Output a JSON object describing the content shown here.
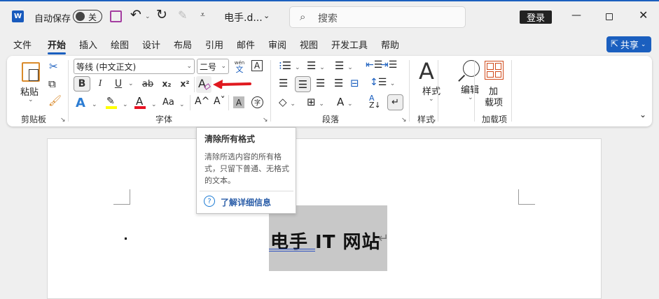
{
  "titlebar": {
    "app_icon": "word-icon",
    "autosave_label": "自动保存",
    "autosave_toggle": "关",
    "doc_title": "电手.d...",
    "search_placeholder": "搜索",
    "login_label": "登录"
  },
  "tabs": [
    "文件",
    "开始",
    "插入",
    "绘图",
    "设计",
    "布局",
    "引用",
    "邮件",
    "审阅",
    "视图",
    "开发工具",
    "帮助"
  ],
  "share_label": "共享",
  "ribbon": {
    "clipboard": {
      "paste": "粘贴",
      "group": "剪贴板"
    },
    "font": {
      "font_name": "等线 (中文正文)",
      "font_size": "二号",
      "phonetic": "wén",
      "phonetic_char": "文",
      "bold": "B",
      "italic": "I",
      "underline": "U",
      "strike": "ab",
      "sub": "x₂",
      "sup": "x²",
      "case": "Aa",
      "grow": "A^",
      "shrink": "Aˇ",
      "shade": "A",
      "enclose": "字",
      "group": "字体"
    },
    "paragraph": {
      "group": "段落"
    },
    "styles": {
      "label": "样式",
      "group": "样式"
    },
    "editing": {
      "label": "编辑"
    },
    "addins": {
      "label_1": "加",
      "label_2": "载项",
      "group": "加载项"
    }
  },
  "tooltip": {
    "title": "清除所有格式",
    "body": "清除所选内容的所有格式，只留下普通、无格式的文本。",
    "link": "了解详细信息"
  },
  "document": {
    "text": "电手 IT 网站"
  },
  "colors": {
    "accent": "#1b5fbf",
    "highlight": "#ffff00",
    "font_color": "#e81123",
    "arrow": "#e0191f",
    "selection": "#c8c8c8"
  }
}
